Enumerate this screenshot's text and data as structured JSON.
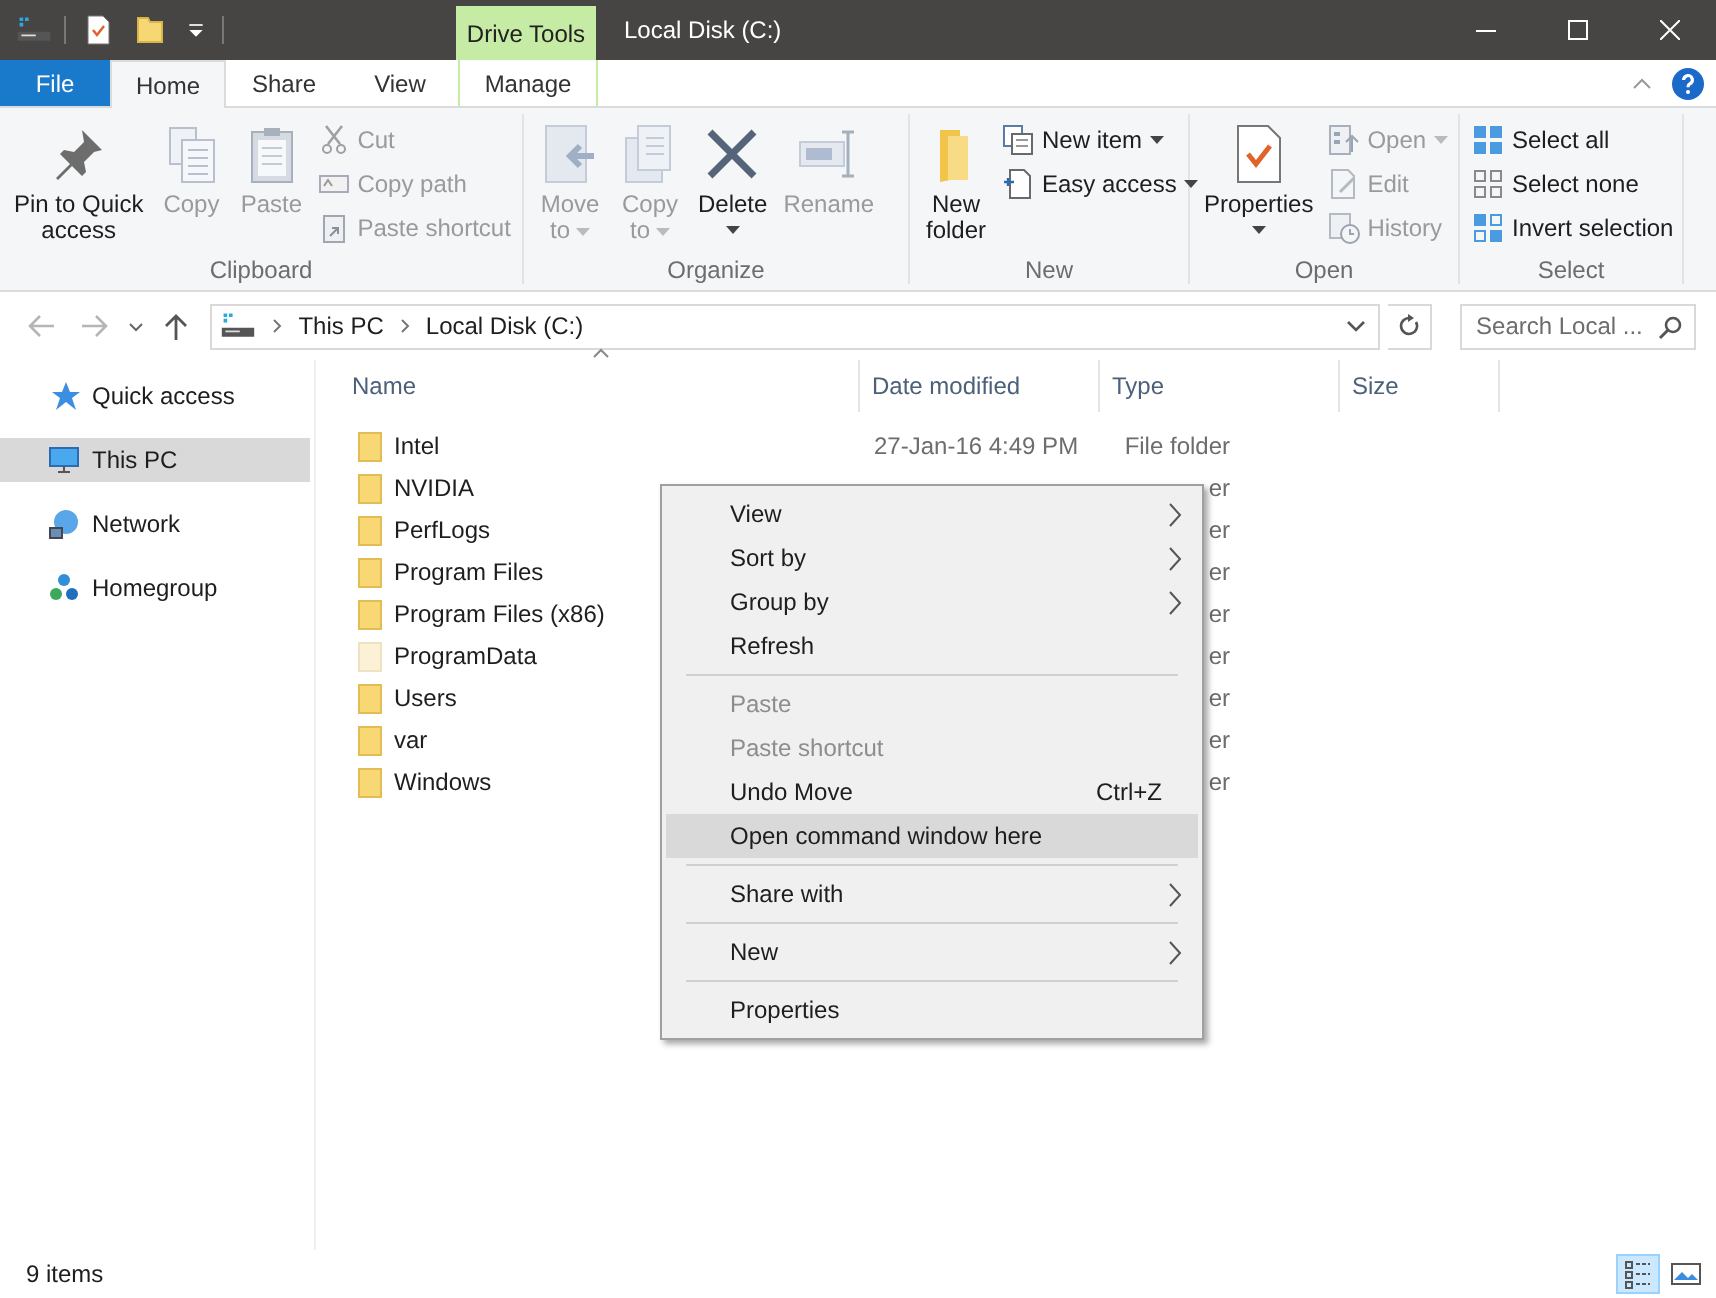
{
  "window": {
    "title": "Local Disk (C:)",
    "context_tab": "Drive Tools"
  },
  "ribbon_tabs": [
    {
      "label": "File",
      "kind": "file",
      "selected": false
    },
    {
      "label": "Home",
      "kind": "tab",
      "selected": true
    },
    {
      "label": "Share",
      "kind": "tab",
      "selected": false
    },
    {
      "label": "View",
      "kind": "tab",
      "selected": false
    },
    {
      "label": "Manage",
      "kind": "context",
      "selected": false
    }
  ],
  "ribbon_groups": [
    {
      "label": "Clipboard",
      "items": [
        {
          "kind": "large",
          "label": "Pin to Quick access",
          "disabled": false,
          "dropdown": false
        },
        {
          "kind": "large",
          "label": "Copy",
          "disabled": true,
          "dropdown": false
        },
        {
          "kind": "large",
          "label": "Paste",
          "disabled": true,
          "dropdown": false
        },
        {
          "kind": "stack",
          "items": [
            {
              "label": "Cut",
              "disabled": true,
              "dropdown": false
            },
            {
              "label": "Copy path",
              "disabled": true,
              "dropdown": false
            },
            {
              "label": "Paste shortcut",
              "disabled": true,
              "dropdown": false
            }
          ]
        }
      ]
    },
    {
      "label": "Organize",
      "items": [
        {
          "kind": "large",
          "label": "Move to",
          "disabled": true,
          "dropdown": true
        },
        {
          "kind": "large",
          "label": "Copy to",
          "disabled": true,
          "dropdown": true
        },
        {
          "kind": "large",
          "label": "Delete",
          "disabled": false,
          "dropdown": true
        },
        {
          "kind": "large",
          "label": "Rename",
          "disabled": true,
          "dropdown": false
        }
      ]
    },
    {
      "label": "New",
      "items": [
        {
          "kind": "large",
          "label": "New folder",
          "disabled": false,
          "dropdown": false
        },
        {
          "kind": "stack",
          "items": [
            {
              "label": "New item",
              "disabled": false,
              "dropdown": true
            },
            {
              "label": "Easy access",
              "disabled": false,
              "dropdown": true
            }
          ]
        }
      ]
    },
    {
      "label": "Open",
      "items": [
        {
          "kind": "large",
          "label": "Properties",
          "disabled": false,
          "dropdown": true
        },
        {
          "kind": "stack",
          "items": [
            {
              "label": "Open",
              "disabled": true,
              "dropdown": true
            },
            {
              "label": "Edit",
              "disabled": true,
              "dropdown": false
            },
            {
              "label": "History",
              "disabled": true,
              "dropdown": false
            }
          ]
        }
      ]
    },
    {
      "label": "Select",
      "items": [
        {
          "kind": "stack",
          "items": [
            {
              "label": "Select all",
              "disabled": false,
              "dropdown": false
            },
            {
              "label": "Select none",
              "disabled": false,
              "dropdown": false
            },
            {
              "label": "Invert selection",
              "disabled": false,
              "dropdown": false
            }
          ]
        }
      ]
    }
  ],
  "navigation": {
    "back_disabled": true,
    "forward_disabled": true
  },
  "address_bar": {
    "crumbs": [
      "This PC",
      "Local Disk (C:)"
    ]
  },
  "search": {
    "placeholder": "Search Local ..."
  },
  "sidebar": {
    "items": [
      {
        "label": "Quick access",
        "selected": false
      },
      {
        "label": "This PC",
        "selected": true
      },
      {
        "label": "Network",
        "selected": false
      },
      {
        "label": "Homegroup",
        "selected": false
      }
    ]
  },
  "table": {
    "columns": [
      "Name",
      "Date modified",
      "Type",
      "Size"
    ],
    "rows": [
      {
        "name": "Intel",
        "date": "27-Jan-16 4:49 PM",
        "type": "File folder",
        "hidden": false
      },
      {
        "name": "NVIDIA",
        "type": "er",
        "hidden": false
      },
      {
        "name": "PerfLogs",
        "type": "er",
        "hidden": false
      },
      {
        "name": "Program Files",
        "type": "er",
        "hidden": false
      },
      {
        "name": "Program Files (x86)",
        "type": "er",
        "hidden": false
      },
      {
        "name": "ProgramData",
        "type": "er",
        "hidden": true
      },
      {
        "name": "Users",
        "type": "er",
        "hidden": false
      },
      {
        "name": "var",
        "type": "er",
        "hidden": false
      },
      {
        "name": "Windows",
        "type": "er",
        "hidden": false
      }
    ]
  },
  "context_menu": [
    {
      "kind": "item",
      "label": "View",
      "submenu": true,
      "disabled": false,
      "selected": false
    },
    {
      "kind": "item",
      "label": "Sort by",
      "submenu": true,
      "disabled": false,
      "selected": false
    },
    {
      "kind": "item",
      "label": "Group by",
      "submenu": true,
      "disabled": false,
      "selected": false
    },
    {
      "kind": "item",
      "label": "Refresh",
      "submenu": false,
      "disabled": false,
      "selected": false
    },
    {
      "kind": "separator"
    },
    {
      "kind": "item",
      "label": "Paste",
      "submenu": false,
      "disabled": true,
      "selected": false
    },
    {
      "kind": "item",
      "label": "Paste shortcut",
      "submenu": false,
      "disabled": true,
      "selected": false
    },
    {
      "kind": "item",
      "label": "Undo Move",
      "shortcut": "Ctrl+Z",
      "submenu": false,
      "disabled": false,
      "selected": false
    },
    {
      "kind": "item",
      "label": "Open command window here",
      "submenu": false,
      "disabled": false,
      "selected": true
    },
    {
      "kind": "separator"
    },
    {
      "kind": "item",
      "label": "Share with",
      "submenu": true,
      "disabled": false,
      "selected": false
    },
    {
      "kind": "separator"
    },
    {
      "kind": "item",
      "label": "New",
      "submenu": true,
      "disabled": false,
      "selected": false
    },
    {
      "kind": "separator"
    },
    {
      "kind": "item",
      "label": "Properties",
      "submenu": false,
      "disabled": false,
      "selected": false
    }
  ],
  "status_bar": {
    "item_count": "9 items",
    "views": [
      {
        "selected": true
      },
      {
        "selected": false
      }
    ]
  }
}
